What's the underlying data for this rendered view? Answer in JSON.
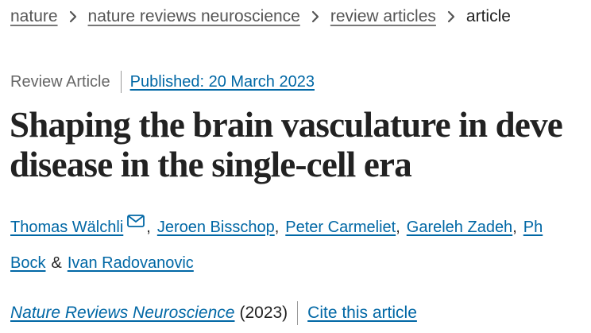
{
  "breadcrumb": {
    "items": [
      "nature",
      "nature reviews neuroscience",
      "review articles"
    ],
    "current": "article",
    "separator_icon": "chevron-right-icon"
  },
  "meta": {
    "article_type": "Review Article",
    "published": "Published: 20 March 2023"
  },
  "title": {
    "line1": "Shaping the brain vasculature in deve",
    "line2": "disease in the single-cell era"
  },
  "authors": {
    "line1": [
      "Thomas Wälchli",
      "Jeroen Bisschop",
      "Peter Carmeliet",
      "Gareleh Zadeh",
      "Ph"
    ],
    "line2": [
      "Bock",
      "Ivan Radovanovic"
    ],
    "separator": ",",
    "ampersand": "&",
    "mail_icon": "mail-icon"
  },
  "citation": {
    "journal": "Nature Reviews Neuroscience",
    "year": "(2023)",
    "cite_label": "Cite this article"
  },
  "colors": {
    "link": "#0067a5",
    "text": "#222222",
    "muted": "#666666"
  }
}
